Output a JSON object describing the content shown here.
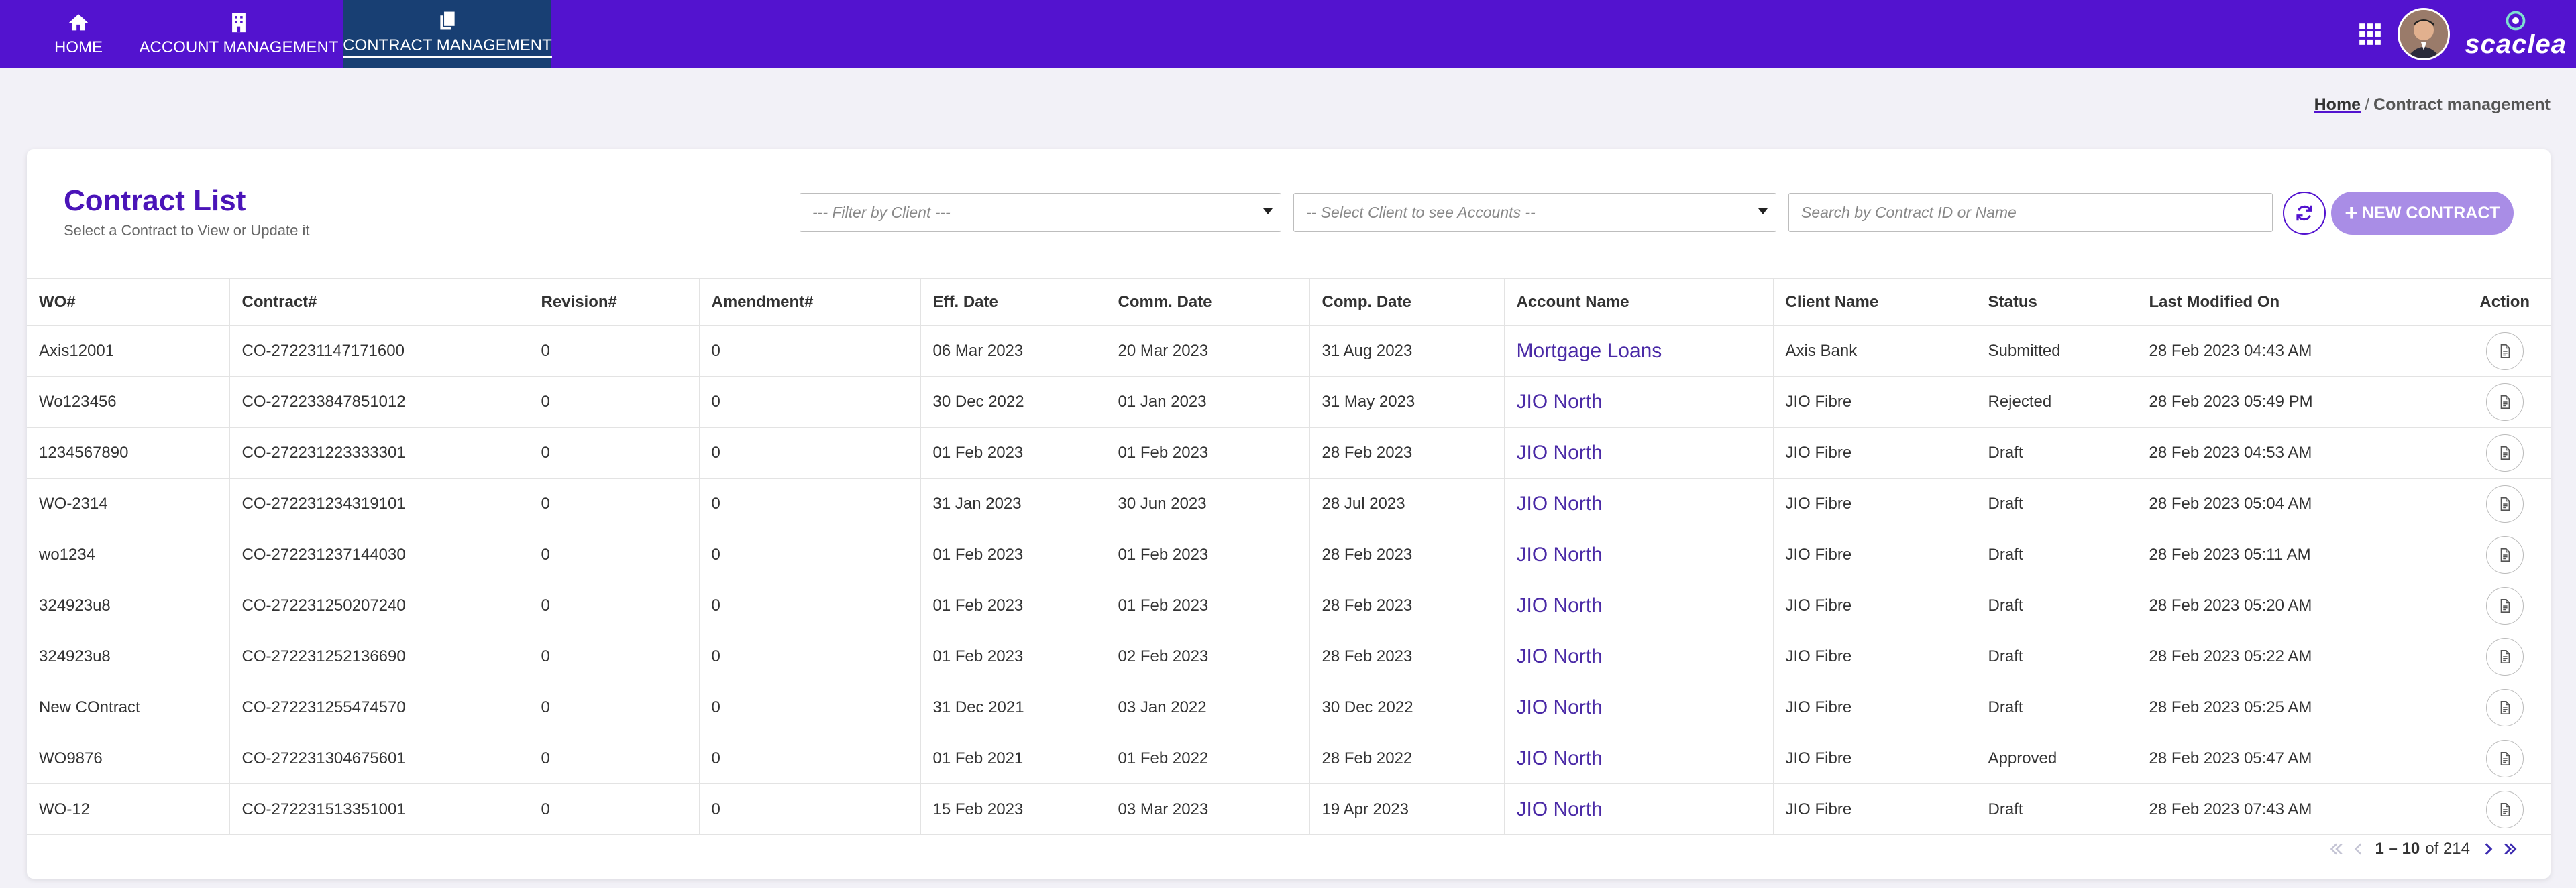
{
  "nav": {
    "items": [
      {
        "label": "HOME",
        "icon": "home-icon"
      },
      {
        "label": "ACCOUNT MANAGEMENT",
        "icon": "building-icon"
      },
      {
        "label": "CONTRACT MANAGEMENT",
        "icon": "documents-icon",
        "active": true
      }
    ],
    "brand": "scaclea"
  },
  "breadcrumb": {
    "home": "Home",
    "separator": "/",
    "current": "Contract management"
  },
  "header": {
    "title": "Contract List",
    "subtitle": "Select a Contract to View or Update it"
  },
  "filters": {
    "client_placeholder": "--- Filter by Client ---",
    "accounts_placeholder": "-- Select Client to see Accounts --",
    "search_placeholder": "Search by Contract ID or Name",
    "new_contract_label": "NEW CONTRACT"
  },
  "table": {
    "columns": [
      "WO#",
      "Contract#",
      "Revision#",
      "Amendment#",
      "Eff. Date",
      "Comm. Date",
      "Comp. Date",
      "Account Name",
      "Client Name",
      "Status",
      "Last Modified On",
      "Action"
    ],
    "rows": [
      {
        "wo": "Axis12001",
        "contract": "CO-272231147171600",
        "revision": "0",
        "amendment": "0",
        "eff": "06 Mar 2023",
        "comm": "20 Mar 2023",
        "comp": "31 Aug 2023",
        "account": "Mortgage Loans",
        "client": "Axis Bank",
        "status": "Submitted",
        "modified": "28 Feb 2023 04:43 AM"
      },
      {
        "wo": "Wo123456",
        "contract": "CO-272233847851012",
        "revision": "0",
        "amendment": "0",
        "eff": "30 Dec 2022",
        "comm": "01 Jan 2023",
        "comp": "31 May 2023",
        "account": "JIO North",
        "client": "JIO Fibre",
        "status": "Rejected",
        "modified": "28 Feb 2023 05:49 PM"
      },
      {
        "wo": "1234567890",
        "contract": "CO-272231223333301",
        "revision": "0",
        "amendment": "0",
        "eff": "01 Feb 2023",
        "comm": "01 Feb 2023",
        "comp": "28 Feb 2023",
        "account": "JIO North",
        "client": "JIO Fibre",
        "status": "Draft",
        "modified": "28 Feb 2023 04:53 AM"
      },
      {
        "wo": "WO-2314",
        "contract": "CO-272231234319101",
        "revision": "0",
        "amendment": "0",
        "eff": "31 Jan 2023",
        "comm": "30 Jun 2023",
        "comp": "28 Jul 2023",
        "account": "JIO North",
        "client": "JIO Fibre",
        "status": "Draft",
        "modified": "28 Feb 2023 05:04 AM"
      },
      {
        "wo": "wo1234",
        "contract": "CO-272231237144030",
        "revision": "0",
        "amendment": "0",
        "eff": "01 Feb 2023",
        "comm": "01 Feb 2023",
        "comp": "28 Feb 2023",
        "account": "JIO North",
        "client": "JIO Fibre",
        "status": "Draft",
        "modified": "28 Feb 2023 05:11 AM"
      },
      {
        "wo": "324923u8",
        "contract": "CO-272231250207240",
        "revision": "0",
        "amendment": "0",
        "eff": "01 Feb 2023",
        "comm": "01 Feb 2023",
        "comp": "28 Feb 2023",
        "account": "JIO North",
        "client": "JIO Fibre",
        "status": "Draft",
        "modified": "28 Feb 2023 05:20 AM"
      },
      {
        "wo": "324923u8",
        "contract": "CO-272231252136690",
        "revision": "0",
        "amendment": "0",
        "eff": "01 Feb 2023",
        "comm": "02 Feb 2023",
        "comp": "28 Feb 2023",
        "account": "JIO North",
        "client": "JIO Fibre",
        "status": "Draft",
        "modified": "28 Feb 2023 05:22 AM"
      },
      {
        "wo": "New COntract",
        "contract": "CO-272231255474570",
        "revision": "0",
        "amendment": "0",
        "eff": "31 Dec 2021",
        "comm": "03 Jan 2022",
        "comp": "30 Dec 2022",
        "account": "JIO North",
        "client": "JIO Fibre",
        "status": "Draft",
        "modified": "28 Feb 2023 05:25 AM"
      },
      {
        "wo": "WO9876",
        "contract": "CO-272231304675601",
        "revision": "0",
        "amendment": "0",
        "eff": "01 Feb 2021",
        "comm": "01 Feb 2022",
        "comp": "28 Feb 2022",
        "account": "JIO North",
        "client": "JIO Fibre",
        "status": "Approved",
        "modified": "28 Feb 2023 05:47 AM"
      },
      {
        "wo": "WO-12",
        "contract": "CO-272231513351001",
        "revision": "0",
        "amendment": "0",
        "eff": "15 Feb 2023",
        "comm": "03 Mar 2023",
        "comp": "19 Apr 2023",
        "account": "JIO North",
        "client": "JIO Fibre",
        "status": "Draft",
        "modified": "28 Feb 2023 07:43 AM"
      }
    ]
  },
  "pagination": {
    "range": "1 – 10",
    "of_label": "of 214"
  },
  "colors": {
    "nav_bg": "#5313cf",
    "nav_active_bg": "#183f73",
    "title": "#4a14b8",
    "status_submitted": "#3b3fa8",
    "status_rejected": "#c0283c",
    "status_draft": "#e0a018",
    "status_approved": "#3ca83c"
  }
}
